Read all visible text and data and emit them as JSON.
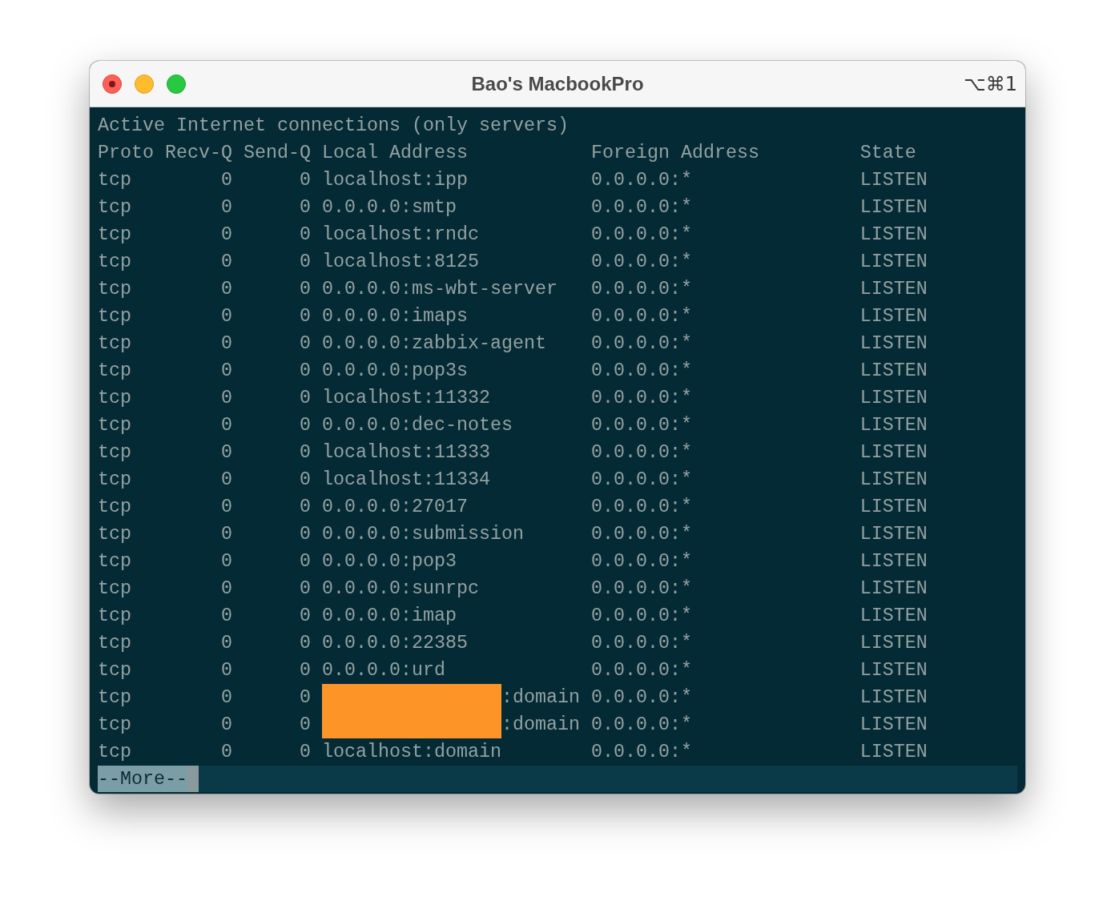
{
  "window": {
    "title": "Bao's MacbookPro",
    "shortcut": "⌥⌘1"
  },
  "terminal": {
    "heading": "Active Internet connections (only servers)",
    "columns": [
      "Proto",
      "Recv-Q",
      "Send-Q",
      "Local Address",
      "Foreign Address",
      "State"
    ],
    "rows": [
      {
        "proto": "tcp",
        "recv_q": "0",
        "send_q": "0",
        "local": "localhost:ipp",
        "foreign": "0.0.0.0:*",
        "state": "LISTEN",
        "redacted": false
      },
      {
        "proto": "tcp",
        "recv_q": "0",
        "send_q": "0",
        "local": "0.0.0.0:smtp",
        "foreign": "0.0.0.0:*",
        "state": "LISTEN",
        "redacted": false
      },
      {
        "proto": "tcp",
        "recv_q": "0",
        "send_q": "0",
        "local": "localhost:rndc",
        "foreign": "0.0.0.0:*",
        "state": "LISTEN",
        "redacted": false
      },
      {
        "proto": "tcp",
        "recv_q": "0",
        "send_q": "0",
        "local": "localhost:8125",
        "foreign": "0.0.0.0:*",
        "state": "LISTEN",
        "redacted": false
      },
      {
        "proto": "tcp",
        "recv_q": "0",
        "send_q": "0",
        "local": "0.0.0.0:ms-wbt-server",
        "foreign": "0.0.0.0:*",
        "state": "LISTEN",
        "redacted": false
      },
      {
        "proto": "tcp",
        "recv_q": "0",
        "send_q": "0",
        "local": "0.0.0.0:imaps",
        "foreign": "0.0.0.0:*",
        "state": "LISTEN",
        "redacted": false
      },
      {
        "proto": "tcp",
        "recv_q": "0",
        "send_q": "0",
        "local": "0.0.0.0:zabbix-agent",
        "foreign": "0.0.0.0:*",
        "state": "LISTEN",
        "redacted": false
      },
      {
        "proto": "tcp",
        "recv_q": "0",
        "send_q": "0",
        "local": "0.0.0.0:pop3s",
        "foreign": "0.0.0.0:*",
        "state": "LISTEN",
        "redacted": false
      },
      {
        "proto": "tcp",
        "recv_q": "0",
        "send_q": "0",
        "local": "localhost:11332",
        "foreign": "0.0.0.0:*",
        "state": "LISTEN",
        "redacted": false
      },
      {
        "proto": "tcp",
        "recv_q": "0",
        "send_q": "0",
        "local": "0.0.0.0:dec-notes",
        "foreign": "0.0.0.0:*",
        "state": "LISTEN",
        "redacted": false
      },
      {
        "proto": "tcp",
        "recv_q": "0",
        "send_q": "0",
        "local": "localhost:11333",
        "foreign": "0.0.0.0:*",
        "state": "LISTEN",
        "redacted": false
      },
      {
        "proto": "tcp",
        "recv_q": "0",
        "send_q": "0",
        "local": "localhost:11334",
        "foreign": "0.0.0.0:*",
        "state": "LISTEN",
        "redacted": false
      },
      {
        "proto": "tcp",
        "recv_q": "0",
        "send_q": "0",
        "local": "0.0.0.0:27017",
        "foreign": "0.0.0.0:*",
        "state": "LISTEN",
        "redacted": false
      },
      {
        "proto": "tcp",
        "recv_q": "0",
        "send_q": "0",
        "local": "0.0.0.0:submission",
        "foreign": "0.0.0.0:*",
        "state": "LISTEN",
        "redacted": false
      },
      {
        "proto": "tcp",
        "recv_q": "0",
        "send_q": "0",
        "local": "0.0.0.0:pop3",
        "foreign": "0.0.0.0:*",
        "state": "LISTEN",
        "redacted": false
      },
      {
        "proto": "tcp",
        "recv_q": "0",
        "send_q": "0",
        "local": "0.0.0.0:sunrpc",
        "foreign": "0.0.0.0:*",
        "state": "LISTEN",
        "redacted": false
      },
      {
        "proto": "tcp",
        "recv_q": "0",
        "send_q": "0",
        "local": "0.0.0.0:imap",
        "foreign": "0.0.0.0:*",
        "state": "LISTEN",
        "redacted": false
      },
      {
        "proto": "tcp",
        "recv_q": "0",
        "send_q": "0",
        "local": "0.0.0.0:22385",
        "foreign": "0.0.0.0:*",
        "state": "LISTEN",
        "redacted": false
      },
      {
        "proto": "tcp",
        "recv_q": "0",
        "send_q": "0",
        "local": "0.0.0.0:urd",
        "foreign": "0.0.0.0:*",
        "state": "LISTEN",
        "redacted": false
      },
      {
        "proto": "tcp",
        "recv_q": "0",
        "send_q": "0",
        "local": ":domain",
        "foreign": "0.0.0.0:*",
        "state": "LISTEN",
        "redacted": true
      },
      {
        "proto": "tcp",
        "recv_q": "0",
        "send_q": "0",
        "local": ":domain",
        "foreign": "0.0.0.0:*",
        "state": "LISTEN",
        "redacted": true
      },
      {
        "proto": "tcp",
        "recv_q": "0",
        "send_q": "0",
        "local": "localhost:domain",
        "foreign": "0.0.0.0:*",
        "state": "LISTEN",
        "redacted": false
      }
    ],
    "pager": {
      "prompt": "--More--"
    }
  }
}
